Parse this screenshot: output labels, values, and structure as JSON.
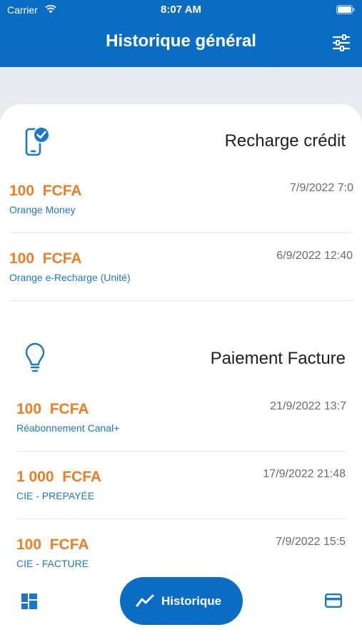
{
  "status_bar": {
    "carrier": "Carrier",
    "time": "8:07 AM"
  },
  "header": {
    "title": "Historique général",
    "filter_icon": "sliders-icon"
  },
  "sections": [
    {
      "title": "Recharge crédit",
      "icon": "phone-check-icon",
      "transactions": [
        {
          "amount": "100  FCFA",
          "label": "Orange Money",
          "date": "7/9/2022 7:0"
        },
        {
          "amount": "100  FCFA",
          "label": "Orange e-Recharge (Unité)",
          "date": "6/9/2022 12:40"
        }
      ]
    },
    {
      "title": "Paiement Facture",
      "icon": "lightbulb-icon",
      "transactions": [
        {
          "amount": "100  FCFA",
          "label": "Réabonnement Canal+",
          "date": "21/9/2022 13:7"
        },
        {
          "amount": "1 000  FCFA",
          "label": "CIE - PREPAYÉE",
          "date": "17/9/2022 21:48"
        },
        {
          "amount": "100  FCFA",
          "label": "CIE - FACTURE",
          "date": "7/9/2022 15:5"
        }
      ]
    }
  ],
  "bottom_nav": {
    "left_icon": "dashboard-icon",
    "main_label": "Historique",
    "main_icon": "trend-line-icon",
    "right_icon": "credit-card-icon"
  },
  "colors": {
    "primary": "#0b6cc4",
    "amount": "#ef7d24",
    "label": "#1b78c8",
    "date": "#6b6b6b"
  }
}
